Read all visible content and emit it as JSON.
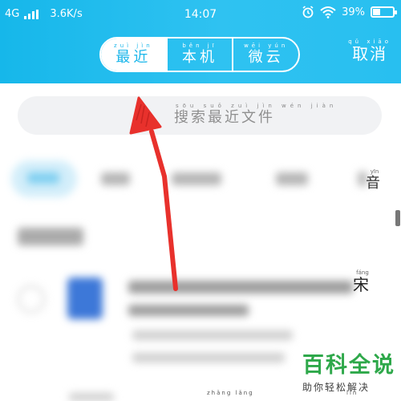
{
  "status_bar": {
    "network": "4G",
    "speed": "3.6K/s",
    "time": "14:07",
    "battery": "39%",
    "battery_level": 0.39,
    "icons": [
      "signal-icon",
      "alarm-icon",
      "wifi-icon",
      "battery-icon"
    ]
  },
  "header": {
    "tabs": [
      {
        "pinyin": "zuì jìn",
        "label": "最近",
        "active": true
      },
      {
        "pinyin": "běn jī",
        "label": "本机",
        "active": false
      },
      {
        "pinyin": "wēi yún",
        "label": "微云",
        "active": false
      }
    ],
    "cancel": {
      "pinyin": "qǔ xiāo",
      "label": "取消"
    }
  },
  "search": {
    "pinyin": "sōu suǒ zuì jìn wén jiàn",
    "placeholder": "搜索最近文件"
  },
  "categories": {
    "last": {
      "pinyin": "yīn",
      "label": "音"
    }
  },
  "list": {
    "partial_char": {
      "pinyin": "fáng",
      "label": "宋"
    }
  },
  "bottom_peek": {
    "items": [
      {
        "pinyin": "zhǎng lǎng"
      },
      {
        "pinyin": "lín"
      }
    ]
  },
  "watermark": {
    "title": "百科全说",
    "subtitle": "助你轻松解决"
  },
  "colors": {
    "header_gradient_start": "#16b7ea",
    "header_gradient_end": "#28bff0",
    "active_tab_text": "#1ab6ea",
    "arrow": "#e8312c",
    "watermark_green": "#2ea84a",
    "file_icon_blue": "#3d78d8"
  }
}
